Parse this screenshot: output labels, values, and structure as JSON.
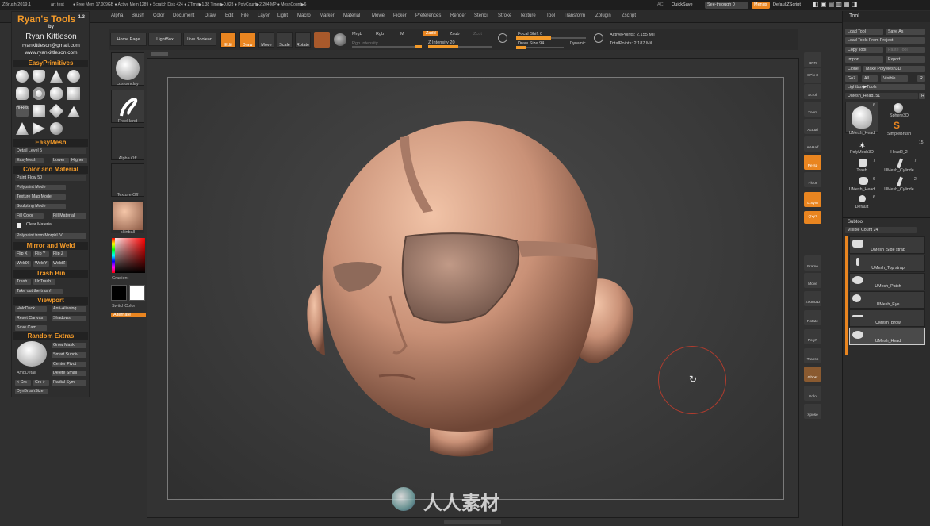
{
  "titlebar": {
    "app": "ZBrush 2019.1",
    "doc": "art test",
    "stats": "● Free Mem 17.009GB ● Active Mem 1289 ● Scratch Disk 424 ● ZTime▶1.38 Timer▶0.028 ● PolyCount▶2.204 MP ● MeshCount▶6",
    "ac": "AC",
    "quicksave": "QuickSave",
    "seethrough": "See-through  0",
    "menus": "Menus",
    "script": "DefaultZScript"
  },
  "menubar": [
    "Alpha",
    "Brush",
    "Color",
    "Document",
    "Draw",
    "Edit",
    "File",
    "Layer",
    "Light",
    "Macro",
    "Marker",
    "Material",
    "Movie",
    "Picker",
    "Preferences",
    "Render",
    "Stencil",
    "Stroke",
    "Texture",
    "Tool",
    "Transform",
    "Zplugin",
    "Zscript"
  ],
  "left_panel": {
    "title": "Ryan's Tools",
    "version": "1.3",
    "by": "by",
    "author": "Ryan Kittleson",
    "email": "ryankittleson@gmail.com",
    "site": "www.ryankittleson.com",
    "easyprimitives": "EasyPrimitives",
    "hires": "Hi-Res",
    "easymesh": "EasyMesh",
    "detail_level": "Detail Level",
    "detail_value": "5",
    "easymesh_btns": [
      "EasyMesh",
      "Lower",
      "Higher"
    ],
    "color_material": "Color and Material",
    "paint_flow": "Paint Flow",
    "paint_flow_value": "50",
    "polypaint_mode": "Polypaint Mode",
    "texture_map_mode": "Texture Map Mode",
    "sculpting_mode": "Sculpting Mode",
    "fill_color": "Fill Color",
    "fill_material": "Fill Material",
    "clear_material": "Clear Material",
    "polypaint_from_morph": "Polypaint from MorphUV",
    "mirror_weld": "Mirror and Weld",
    "flip_btns": [
      "Flip X",
      "Flip Y",
      "Flip Z"
    ],
    "weld_btns": [
      "WeldX",
      "WeldY",
      "WeldZ"
    ],
    "trash_bin": "Trash Bin",
    "trash_btns": [
      "Trash",
      "UnTrash"
    ],
    "take_out": "Take out the trash!",
    "viewport": "Viewport",
    "viewport_btns": [
      "HoloDeck",
      "Anti-Aliasing",
      "Reset Canvas",
      "Shadows",
      "Save Cam"
    ],
    "random_extras": "Random Extras",
    "extras_btns": [
      "Grow Mask",
      "Smart Subdiv",
      "Center Pivot",
      "Delete Small",
      "Radial Sym"
    ],
    "amp_detail": "AmpDetail",
    "crs_btns": [
      "< Crs",
      "Crs >"
    ],
    "dynbrush": "DynBrushSize"
  },
  "quick_col": {
    "brush": "customclay",
    "stroke": "FreeHand",
    "alpha": "Alpha Off",
    "texture": "Texture Off",
    "material": "skinball",
    "gradient": "Gradient",
    "switchcolor": "SwitchColor",
    "alternate": "Alternate"
  },
  "top_controls": {
    "home": "Home Page",
    "lightbox": "LightBox",
    "liveboolean": "Live Boolean",
    "edit": "Edit",
    "draw": "Draw",
    "move": "Move",
    "scale": "Scale",
    "rotate": "Rotate",
    "mrgb": "Mrgb",
    "rgb": "Rgb",
    "m": "M",
    "zadd": "Zadd",
    "zsub": "Zsub",
    "zcut": "Zcut",
    "rgb_intensity": "Rgb Intensity",
    "z_intensity": "Z Intensity",
    "z_intensity_value": "20",
    "focal_shift": "Focal Shift",
    "focal_shift_value": "0",
    "draw_size": "Draw Size",
    "draw_size_value": "94",
    "dynamic": "Dynamic",
    "active_points": "ActivePoints: 2.155 Mil",
    "total_points": "TotalPoints: 2.187 Mil"
  },
  "nav_col": [
    "BPR",
    "SPix 3",
    "Scroll",
    "Zoom",
    "Actual",
    "AAHalf",
    "Persp",
    "Floor",
    "L.Sym",
    "Qxyz",
    "Frame",
    "Move",
    "Zoom3D",
    "Rotate",
    "PolyF",
    "Transp",
    "Ghost",
    "Solo",
    "Xpose"
  ],
  "tool_palette": {
    "title": "Tool",
    "btns": [
      "Load Tool",
      "Save As",
      "Load Tools From Project",
      "Copy Tool",
      "Paste Tool",
      "Import",
      "Export",
      "Clone",
      "Make PolyMesh3D",
      "GoZ",
      "All",
      "Visible",
      "R",
      "Lightbox▶Tools"
    ],
    "current": "UMesh_Head. 51",
    "thumbs": [
      "UMesh_Head",
      "Sphere3D",
      "SimpleBrush",
      "PolyMesh3D",
      "Head2_2",
      "Trash",
      "UMesh_Cylinde",
      "UMesh_Head",
      "UMesh_Cylinde",
      "Default"
    ],
    "counts": [
      "6",
      "15",
      "7",
      "7",
      "6",
      "2",
      "6"
    ],
    "subtool": "Subtool",
    "visible_count": "Visible Count",
    "visible_count_value": "24",
    "subtools": [
      "UMesh_Side strap",
      "UMesh_Top strap",
      "UMesh_Patch",
      "UMesh_Eye",
      "UMesh_Brow",
      "UMesh_Head"
    ]
  },
  "watermark": "人人素材",
  "colors": {
    "accent": "#f39a29",
    "panel": "#2e2e2e",
    "skin": "#c98e72"
  }
}
